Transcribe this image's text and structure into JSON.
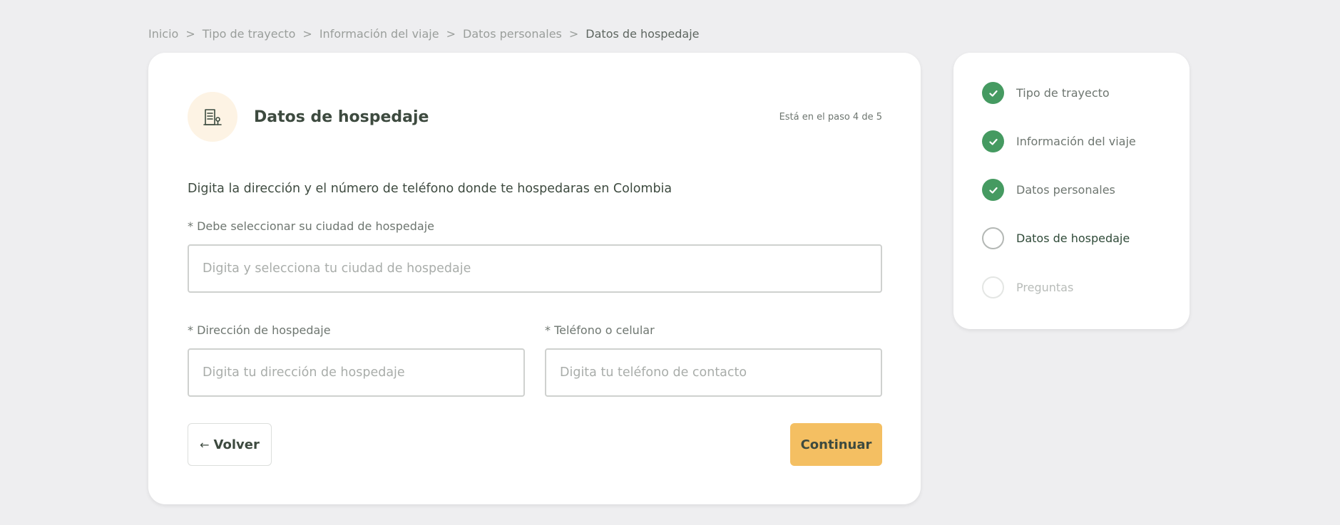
{
  "breadcrumb": {
    "items": [
      "Inicio",
      "Tipo de trayecto",
      "Información del viaje",
      "Datos personales"
    ],
    "current": "Datos de hospedaje",
    "separator": ">"
  },
  "card": {
    "icon": "building-icon",
    "title": "Datos de hospedaje",
    "step_text": "Está en el paso 4 de 5",
    "instruction": "Digita la dirección y el número de teléfono donde te hospedaras en Colombia",
    "city": {
      "label": "* Debe seleccionar su ciudad de hospedaje",
      "placeholder": "Digita y selecciona tu ciudad de hospedaje",
      "value": ""
    },
    "address": {
      "label": "* Dirección de hospedaje",
      "placeholder": "Digita tu dirección de hospedaje",
      "value": ""
    },
    "phone": {
      "label": "* Teléfono o celular",
      "placeholder": "Digita tu teléfono de contacto",
      "value": ""
    },
    "back_button": "Volver",
    "back_icon": "arrow-left-icon",
    "continue_button": "Continuar"
  },
  "stepper": {
    "steps": [
      {
        "label": "Tipo de trayecto",
        "status": "done"
      },
      {
        "label": "Información del viaje",
        "status": "done"
      },
      {
        "label": "Datos personales",
        "status": "done"
      },
      {
        "label": "Datos de hospedaje",
        "status": "current"
      },
      {
        "label": "Preguntas",
        "status": "pending"
      }
    ]
  },
  "colors": {
    "background": "#eeeef0",
    "accent": "#f4bf62",
    "done": "#459a61",
    "text": "#3d4a3f"
  }
}
